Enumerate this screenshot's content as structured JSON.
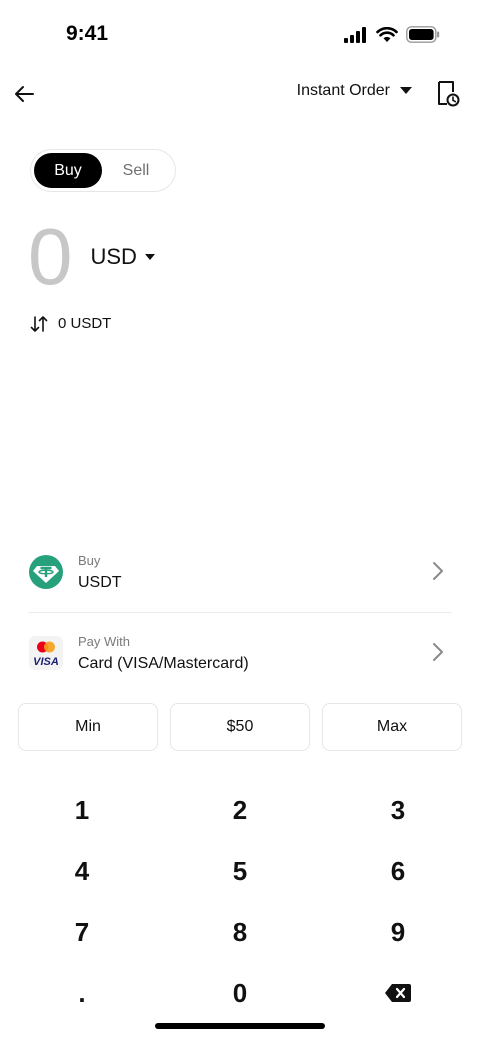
{
  "status_bar": {
    "time": "9:41"
  },
  "nav": {
    "order_type": "Instant Order"
  },
  "trade_toggle": {
    "buy": "Buy",
    "sell": "Sell",
    "selected": "Buy"
  },
  "amount": {
    "value": "0",
    "currency": "USD"
  },
  "conversion": {
    "text": "0 USDT"
  },
  "buy_asset": {
    "caption": "Buy",
    "value": "USDT",
    "icon": "tether-icon"
  },
  "payment": {
    "caption": "Pay With",
    "value": "Card (VISA/Mastercard)",
    "icon": "visa-mastercard-icon",
    "visa_text": "VISA"
  },
  "quick_amounts": [
    "Min",
    "$50",
    "Max"
  ],
  "keypad": {
    "keys": [
      "1",
      "2",
      "3",
      "4",
      "5",
      "6",
      "7",
      "8",
      "9",
      ".",
      "0"
    ],
    "backspace_icon": "backspace-icon"
  },
  "colors": {
    "accent": "#000000",
    "tether": "#26A17B",
    "placeholder": "#c7c7c7"
  }
}
